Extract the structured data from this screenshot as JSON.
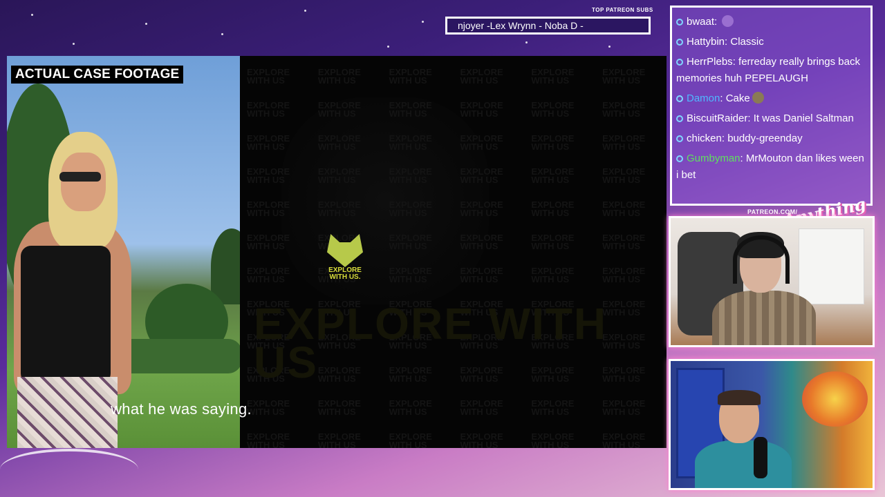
{
  "ticker": {
    "label": "TOP PATREON SUBS",
    "text": "njoyer -Lex Wrynn -  Noba D -"
  },
  "video": {
    "footage_label": "ACTUAL CASE FOOTAGE",
    "subtitle": "what he was saying.",
    "watermark_text": "EXPLORE WITH US",
    "logo_text": "EXPLORE WITH US."
  },
  "chat": {
    "messages": [
      {
        "user": "bwaat",
        "text": "",
        "user_color": "#ffffff",
        "emote": "purple-emote"
      },
      {
        "user": "Hattybin",
        "text": "Classic",
        "user_color": "#ffffff"
      },
      {
        "user": "HerrPlebs",
        "text": "ferreday really brings back memories huh PEPELAUGH",
        "user_color": "#ffffff"
      },
      {
        "user": "Damon",
        "text": "Cake",
        "user_color": "#4fb8ff",
        "emote": "cake-emote"
      },
      {
        "user": "BiscuitRaider",
        "text": "It was Daniel Saltman",
        "user_color": "#ffffff"
      },
      {
        "user": "chicken",
        "text": "buddy-greenday",
        "user_color": "#ffffff"
      },
      {
        "user": "Gumbyman",
        "text": "MrMouton dan likes ween i bet",
        "user_color": "#5fe05f"
      }
    ]
  },
  "branding": {
    "patreon": "PATREON.COM/",
    "name": "Anything Else"
  },
  "colors": {
    "accent_pink": "#ff7fd0",
    "chat_bg": "#8a56d4",
    "bullet": "#7fd6ff"
  }
}
